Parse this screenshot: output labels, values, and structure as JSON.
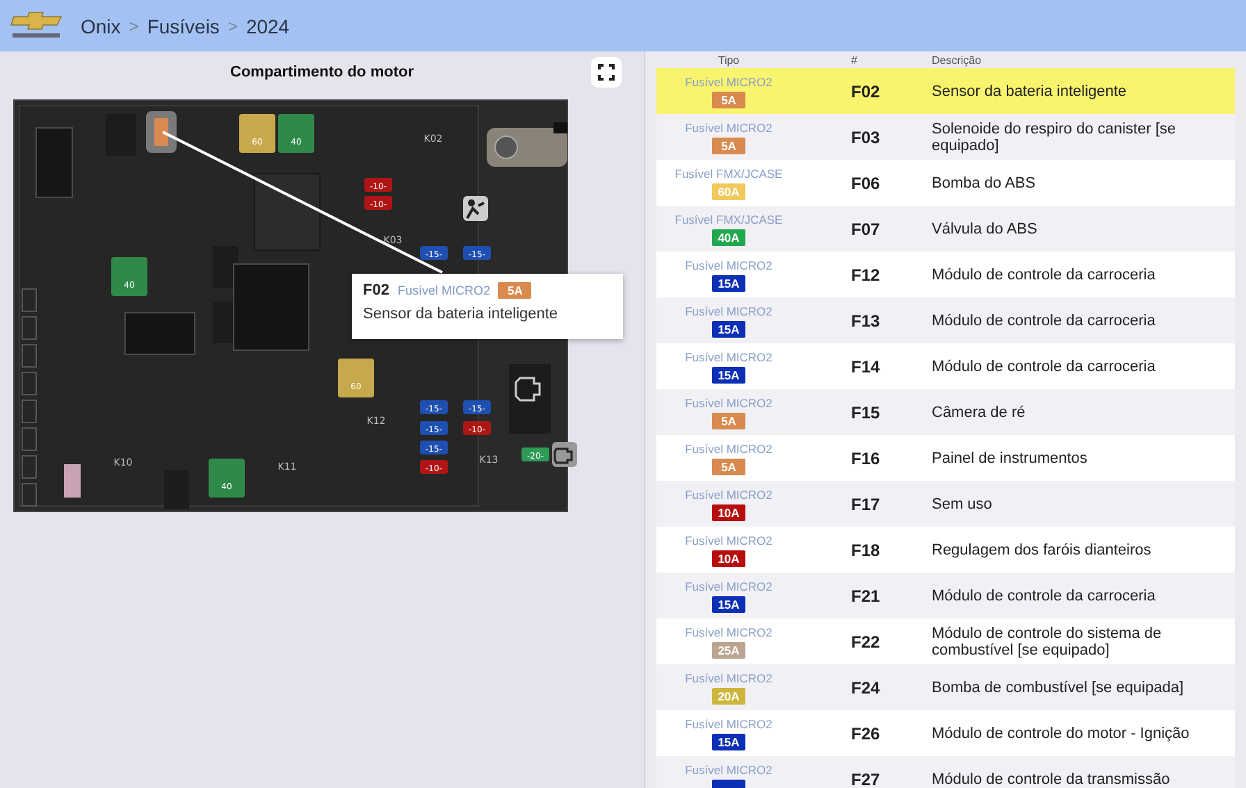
{
  "header": {
    "breadcrumb": [
      "Onix",
      "Fusíveis",
      "2024"
    ],
    "separator": ">"
  },
  "diagram": {
    "title": "Compartimento do motor",
    "relays": [
      "K02",
      "K03",
      "K10",
      "K11",
      "K12",
      "K13"
    ],
    "fuses": [
      {
        "kind": "maxi",
        "label": "60",
        "color": "#c7a84a"
      },
      {
        "kind": "maxi",
        "label": "40",
        "color": "#2f8a4a"
      },
      {
        "kind": "maxi",
        "label": "40",
        "color": "#2f8a4a"
      },
      {
        "kind": "maxi",
        "label": "60",
        "color": "#c7a84a"
      },
      {
        "kind": "maxi",
        "label": "40",
        "color": "#2f8a4a"
      },
      {
        "kind": "mini",
        "label": "-10-",
        "color": "#b01515"
      },
      {
        "kind": "mini",
        "label": "-10-",
        "color": "#b01515"
      },
      {
        "kind": "mini",
        "label": "-15-",
        "color": "#1f4fb0"
      },
      {
        "kind": "mini",
        "label": "-15-",
        "color": "#1f4fb0"
      },
      {
        "kind": "mini",
        "label": "-15-",
        "color": "#1f4fb0"
      },
      {
        "kind": "mini",
        "label": "-15-",
        "color": "#1f4fb0"
      },
      {
        "kind": "mini",
        "label": "-15-",
        "color": "#1f4fb0"
      },
      {
        "kind": "mini",
        "label": "-10-",
        "color": "#b01515"
      },
      {
        "kind": "mini",
        "label": "-15-",
        "color": "#1f4fb0"
      },
      {
        "kind": "mini",
        "label": "-10-",
        "color": "#b01515"
      },
      {
        "kind": "mini",
        "label": "-20-",
        "color": "#2e9a56"
      }
    ],
    "tooltip": {
      "id": "F02",
      "type": "Fusível MICRO2",
      "amp": "5A",
      "color": "#d98a4e",
      "description": "Sensor da bateria inteligente"
    }
  },
  "table": {
    "columns": [
      "Tipo",
      "#",
      "Descrição"
    ],
    "rows": [
      {
        "type": "Fusível MICRO2",
        "amp": "5A",
        "color": "#d98a4e",
        "id": "F02",
        "description": "Sensor da bateria inteligente",
        "selected": true
      },
      {
        "type": "Fusível MICRO2",
        "amp": "5A",
        "color": "#d98a4e",
        "id": "F03",
        "description": "Solenoide do respiro do canister [se equipado]",
        "selected": false
      },
      {
        "type": "Fusível FMX/JCASE",
        "amp": "60A",
        "color": "#f0c95a",
        "id": "F06",
        "description": "Bomba do ABS",
        "selected": false
      },
      {
        "type": "Fusível FMX/JCASE",
        "amp": "40A",
        "color": "#21a84f",
        "id": "F07",
        "description": "Válvula do ABS",
        "selected": false
      },
      {
        "type": "Fusível MICRO2",
        "amp": "15A",
        "color": "#0c2fb5",
        "id": "F12",
        "description": "Módulo de controle da carroceria",
        "selected": false
      },
      {
        "type": "Fusível MICRO2",
        "amp": "15A",
        "color": "#0c2fb5",
        "id": "F13",
        "description": "Módulo de controle da carroceria",
        "selected": false
      },
      {
        "type": "Fusível MICRO2",
        "amp": "15A",
        "color": "#0c2fb5",
        "id": "F14",
        "description": "Módulo de controle da carroceria",
        "selected": false
      },
      {
        "type": "Fusível MICRO2",
        "amp": "5A",
        "color": "#d98a4e",
        "id": "F15",
        "description": "Câmera de ré",
        "selected": false
      },
      {
        "type": "Fusível MICRO2",
        "amp": "5A",
        "color": "#d98a4e",
        "id": "F16",
        "description": "Painel de instrumentos",
        "selected": false
      },
      {
        "type": "Fusível MICRO2",
        "amp": "10A",
        "color": "#b80d0d",
        "id": "F17",
        "description": "Sem uso",
        "selected": false
      },
      {
        "type": "Fusível MICRO2",
        "amp": "10A",
        "color": "#b80d0d",
        "id": "F18",
        "description": "Regulagem dos faróis dianteiros",
        "selected": false
      },
      {
        "type": "Fusível MICRO2",
        "amp": "15A",
        "color": "#0c2fb5",
        "id": "F21",
        "description": "Módulo de controle da carroceria",
        "selected": false
      },
      {
        "type": "Fusível MICRO2",
        "amp": "25A",
        "color": "#bba591",
        "id": "F22",
        "description": "Módulo de controle do sistema de combustível [se equipado]",
        "selected": false
      },
      {
        "type": "Fusível MICRO2",
        "amp": "20A",
        "color": "#cdb63c",
        "id": "F24",
        "description": "Bomba de combustível [se equipada]",
        "selected": false
      },
      {
        "type": "Fusível MICRO2",
        "amp": "15A",
        "color": "#0c2fb5",
        "id": "F26",
        "description": "Módulo de controle do motor - Ignição",
        "selected": false
      },
      {
        "type": "Fusível MICRO2",
        "color": "#0c2fb5",
        "id": "F27",
        "description": "Módulo de controle da transmissão",
        "selected": false
      }
    ]
  }
}
